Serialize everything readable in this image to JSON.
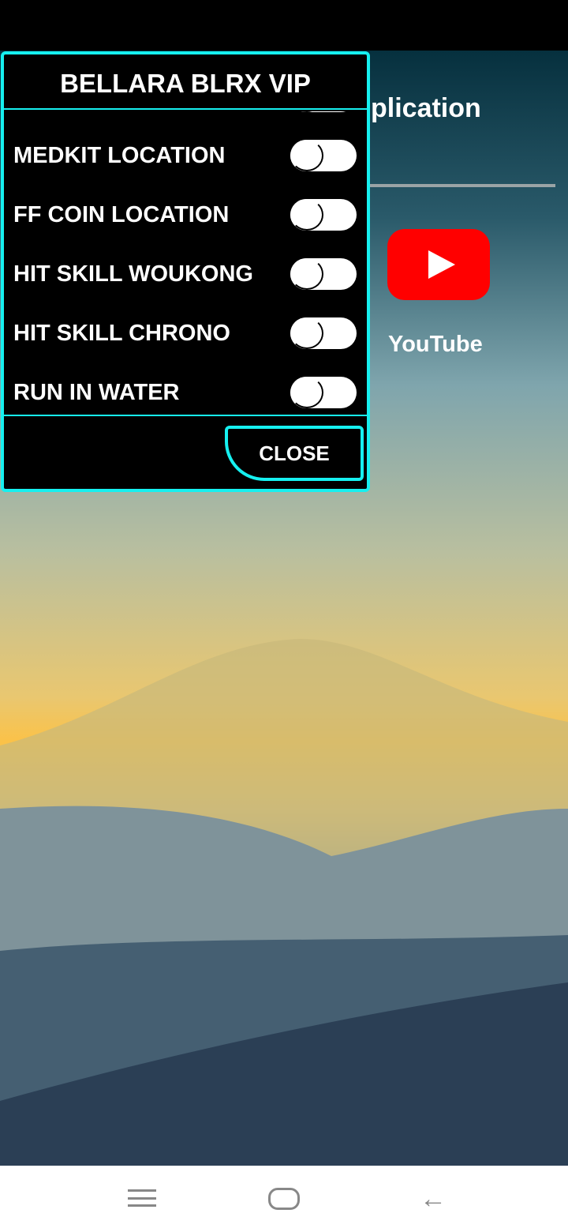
{
  "background": {
    "title_fragment": "plication",
    "app_label": "YouTube",
    "app_icon": "youtube-icon"
  },
  "panel": {
    "title": "BELLARA BLRX VIP",
    "accent": "#16f0f0",
    "items": [
      {
        "label": "",
        "on": false
      },
      {
        "label": "MEDKIT LOCATION",
        "on": false
      },
      {
        "label": "FF COIN LOCATION",
        "on": false
      },
      {
        "label": "HIT SKILL WOUKONG",
        "on": false
      },
      {
        "label": "HIT SKILL CHRONO",
        "on": false
      },
      {
        "label": "RUN IN WATER",
        "on": false
      }
    ],
    "close_label": "CLOSE"
  },
  "navbar": {
    "icons": [
      "menu-icon",
      "home-icon",
      "back-icon"
    ]
  }
}
